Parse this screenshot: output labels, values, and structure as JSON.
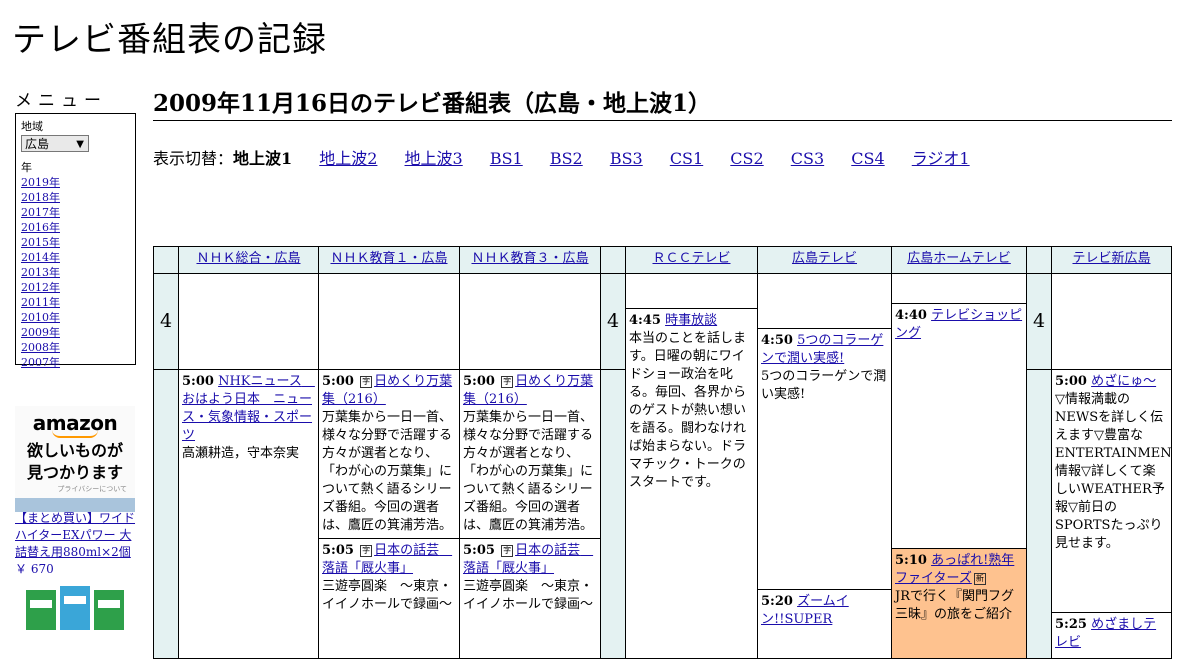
{
  "site_title": "テレビ番組表の記録",
  "sidebar": {
    "menu_heading": "メニュー",
    "region_label": "地域",
    "region_value": "広島",
    "year_label": "年",
    "years": [
      "2019年",
      "2018年",
      "2017年",
      "2016年",
      "2015年",
      "2014年",
      "2013年",
      "2012年",
      "2011年",
      "2010年",
      "2009年",
      "2008年",
      "2007年"
    ]
  },
  "ad": {
    "logo": "amazon",
    "tagline_1": "欲しいものが",
    "tagline_2": "見つかります",
    "privacy": "プライバシーについて",
    "product": "【まとめ買い】ワイドハイターEXパワー 大詰替え用880ml×2個",
    "price": "￥ 670"
  },
  "page_title": "2009年11月16日のテレビ番組表（広島・地上波1）",
  "switcher": {
    "label": "表示切替：",
    "current": "地上波1",
    "links": [
      "地上波2",
      "地上波3",
      "BS1",
      "BS2",
      "BS3",
      "CS1",
      "CS2",
      "CS3",
      "CS4",
      "ラジオ1"
    ]
  },
  "channels": [
    "ＮＨＫ総合・広島",
    "ＮＨＫ教育１・広島",
    "ＮＨＫ教育３・広島",
    "ＲＣＣテレビ",
    "広島テレビ",
    "広島ホームテレビ",
    "テレビ新広島"
  ],
  "hour_label": "4",
  "programs": {
    "nhk_g_500": {
      "time": "5:00",
      "title": "NHKニュース　おはよう日本　ニュース・気象情報・スポーツ",
      "desc": "高瀬耕造，守本奈実"
    },
    "etv1_500": {
      "time": "5:00",
      "title": "日めくり万葉集（216）",
      "desc": "万葉集から一日一首、様々な分野で活躍する方々が選者となり、「わが心の万葉集」について熱く語るシリーズ番組。今回の選者は、鷹匠の箕浦芳浩。"
    },
    "etv1_505": {
      "time": "5:05",
      "title": "日本の話芸　落語「厩火事」",
      "desc": "三遊亭圓楽　～東京・イイノホールで録画～"
    },
    "etv3_500": {
      "time": "5:00",
      "title": "日めくり万葉集（216）",
      "desc": "万葉集から一日一首、様々な分野で活躍する方々が選者となり、「わが心の万葉集」について熱く語るシリーズ番組。今回の選者は、鷹匠の箕浦芳浩。"
    },
    "etv3_505": {
      "time": "5:05",
      "title": "日本の話芸　落語「厩火事」",
      "desc": "三遊亭圓楽　～東京・イイノホールで録画～"
    },
    "rcc_445": {
      "time": "4:45",
      "title": "時事放談",
      "desc": "本当のことを話します。日曜の朝にワイドショー政治を叱る。毎回、各界からのゲストが熱い想いを語る。闘わなければ始まらない。ドラマチック・トークのスタートです。"
    },
    "htv_450": {
      "time": "4:50",
      "title": "5つのコラーゲンで潤い実感!",
      "desc": "5つのコラーゲンで潤い実感!"
    },
    "htv_520": {
      "time": "5:20",
      "title": "ズームイン!!SUPER",
      "desc": ""
    },
    "hometv_440": {
      "time": "4:40",
      "title": "テレビショッピング",
      "desc": ""
    },
    "hometv_510": {
      "time": "5:10",
      "title": "あっぱれ!熟年ファイターズ",
      "desc": "JRで行く『関門フグ三昧』の旅をご紹介"
    },
    "tss_500": {
      "time": "5:00",
      "title": "めざにゅ～",
      "desc": "▽情報満載のNEWSを詳しく伝えます▽豊富なENTERTAINMENT情報▽詳しくて楽しいWEATHER予報▽前日のSPORTSたっぷり見せます。"
    },
    "tss_525": {
      "time": "5:25",
      "title": "めざましテレビ",
      "desc": ""
    }
  },
  "marks": {
    "data_broadcast": "字",
    "new": "新"
  }
}
